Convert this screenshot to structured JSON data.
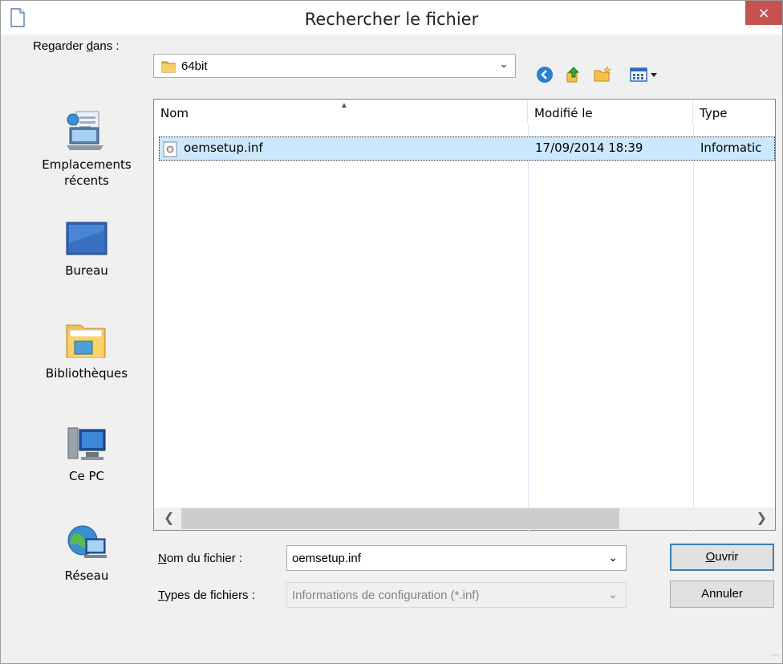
{
  "window": {
    "title": "Rechercher le fichier",
    "close_glyph": "×"
  },
  "lookin": {
    "label_pre": "Regarder ",
    "label_u": "d",
    "label_post": "ans :",
    "value": "64bit"
  },
  "places": [
    {
      "name": "recent-places",
      "label1": "Emplacements",
      "label2": "récents"
    },
    {
      "name": "desktop",
      "label1": "Bureau",
      "label2": ""
    },
    {
      "name": "libraries",
      "label1": "Bibliothèques",
      "label2": ""
    },
    {
      "name": "this-pc",
      "label1": "Ce PC",
      "label2": ""
    },
    {
      "name": "network",
      "label1": "Réseau",
      "label2": ""
    }
  ],
  "columns": {
    "name": "Nom",
    "modified": "Modifié le",
    "type": "Type"
  },
  "files": [
    {
      "name": "oemsetup.inf",
      "modified": "17/09/2014 18:39",
      "type": "Informatic"
    }
  ],
  "filename": {
    "label_u": "N",
    "label_post": "om du fichier :",
    "value": "oemsetup.inf"
  },
  "filetype": {
    "label_u": "T",
    "label_post": "ypes de fichiers :",
    "value": "Informations de configuration (*.inf)"
  },
  "buttons": {
    "open_u": "O",
    "open_post": "uvrir",
    "cancel": "Annuler"
  },
  "colors": {
    "close": "#c75050",
    "selection": "#cce8ff",
    "default_border": "#3c7fb1"
  }
}
